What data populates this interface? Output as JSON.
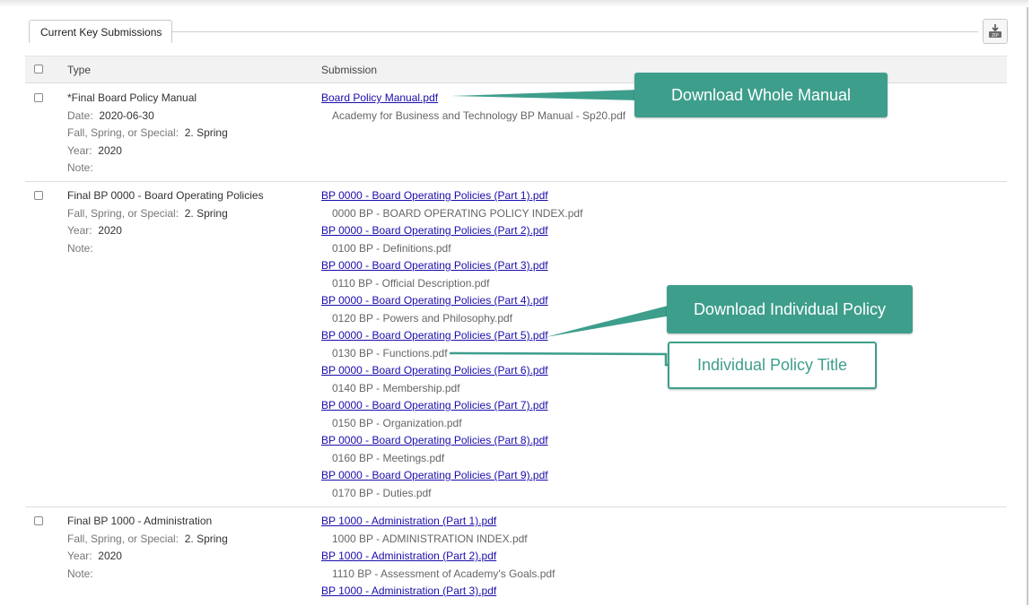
{
  "tab": {
    "label": "Current Key Submissions"
  },
  "zip_button": {
    "icon": "zip-download-icon"
  },
  "table": {
    "headers": {
      "type": "Type",
      "submission": "Submission"
    },
    "rows": [
      {
        "title": "*Final Board Policy Manual",
        "date_label": "Date:",
        "date_value": "2020-06-30",
        "season_label": "Fall, Spring, or Special:",
        "season_value": "2. Spring",
        "year_label": "Year:",
        "year_value": "2020",
        "note_label": "Note:",
        "submissions": [
          {
            "link": "Board Policy Manual.pdf",
            "file": "Academy for Business and Technology BP Manual - Sp20.pdf"
          }
        ]
      },
      {
        "title": "Final BP 0000 - Board Operating Policies",
        "season_label": "Fall, Spring, or Special:",
        "season_value": "2. Spring",
        "year_label": "Year:",
        "year_value": "2020",
        "note_label": "Note:",
        "submissions": [
          {
            "link": "BP 0000 - Board Operating Policies (Part 1).pdf",
            "file": "0000 BP - BOARD OPERATING POLICY INDEX.pdf"
          },
          {
            "link": "BP 0000 - Board Operating Policies (Part 2).pdf",
            "file": "0100 BP - Definitions.pdf"
          },
          {
            "link": "BP 0000 - Board Operating Policies (Part 3).pdf",
            "file": "0110 BP - Official Description.pdf"
          },
          {
            "link": "BP 0000 - Board Operating Policies (Part 4).pdf",
            "file": "0120 BP - Powers and Philosophy.pdf"
          },
          {
            "link": "BP 0000 - Board Operating Policies (Part 5).pdf",
            "file": "0130 BP - Functions.pdf"
          },
          {
            "link": "BP 0000 - Board Operating Policies (Part 6).pdf",
            "file": "0140 BP - Membership.pdf"
          },
          {
            "link": "BP 0000 - Board Operating Policies (Part 7).pdf",
            "file": "0150 BP - Organization.pdf"
          },
          {
            "link": "BP 0000 - Board Operating Policies (Part 8).pdf",
            "file": "0160 BP - Meetings.pdf"
          },
          {
            "link": "BP 0000 - Board Operating Policies (Part 9).pdf",
            "file": "0170 BP - Duties.pdf"
          }
        ]
      },
      {
        "title": "Final BP 1000 - Administration",
        "season_label": "Fall, Spring, or Special:",
        "season_value": "2. Spring",
        "year_label": "Year:",
        "year_value": "2020",
        "note_label": "Note:",
        "submissions": [
          {
            "link": "BP 1000 - Administration (Part 1).pdf",
            "file": "1000 BP - ADMINISTRATION INDEX.pdf"
          },
          {
            "link": "BP 1000 - Administration (Part 2).pdf",
            "file": "1110 BP - Assessment of Academy's Goals.pdf"
          },
          {
            "link": "BP 1000 - Administration (Part 3).pdf"
          }
        ]
      }
    ]
  },
  "callouts": {
    "whole_manual": "Download Whole Manual",
    "individual_policy": "Download Individual Policy",
    "policy_title": "Individual Policy Title"
  },
  "colors": {
    "callout": "#3e9e8c",
    "link": "#1a0dab"
  }
}
